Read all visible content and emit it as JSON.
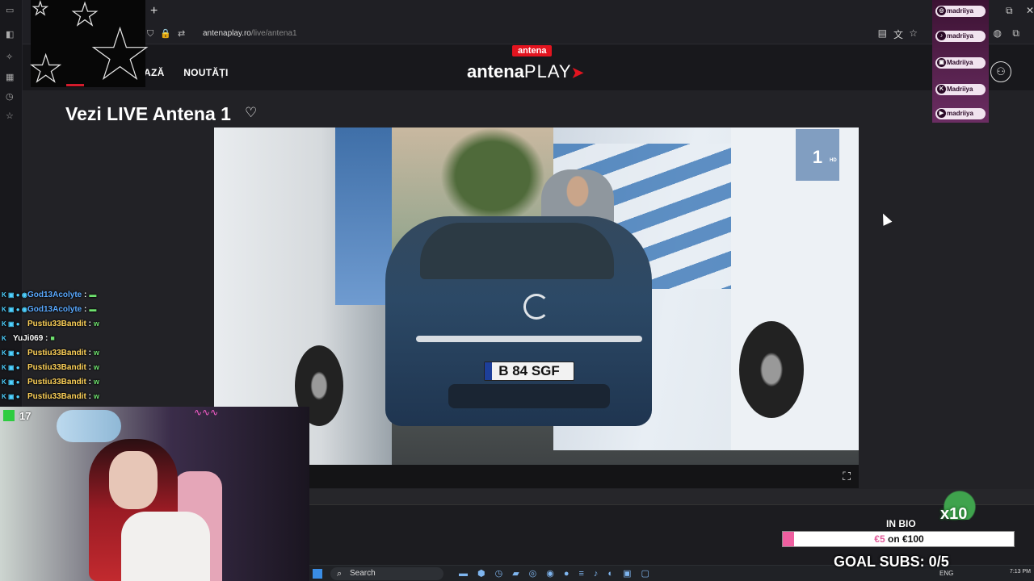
{
  "browser": {
    "new_tab_glyph": "+",
    "url_host": "antenaplay.ro",
    "url_path": "/live/antena1",
    "window_buttons": [
      "⧉",
      "✕"
    ]
  },
  "site": {
    "nav_left": [
      "AZĂ",
      "NOUTĂȚI"
    ],
    "brand_pill": "antena",
    "brand_word": "antena",
    "brand_play": "PLAY",
    "page_title": "Vezi LIVE Antena 1",
    "heart_icon": "♡",
    "user_icon": "⚇"
  },
  "video": {
    "channel_logo": "1",
    "channel_logo_hd": "HD",
    "plate": "B 84 SGF",
    "fullscreen_icon": "⛶"
  },
  "socials": [
    {
      "icon": "◎",
      "handle": "madriiya"
    },
    {
      "icon": "♪",
      "handle": "madriiya"
    },
    {
      "icon": "▣",
      "handle": "Madriiya"
    },
    {
      "icon": "K",
      "handle": "Madriiya"
    },
    {
      "icon": "▶",
      "handle": "madriiya"
    }
  ],
  "chat": [
    {
      "user": "God13Acolyte",
      "color": "blue",
      "emote": "▬"
    },
    {
      "user": "God13Acolyte",
      "color": "blue",
      "emote": "▬"
    },
    {
      "user": "Pustiu33Bandit",
      "color": "yellow",
      "emote": "w"
    },
    {
      "user": "YuJi069",
      "color": "white",
      "emote": "■"
    },
    {
      "user": "Pustiu33Bandit",
      "color": "yellow",
      "emote": "w"
    },
    {
      "user": "Pustiu33Bandit",
      "color": "yellow",
      "emote": "w"
    },
    {
      "user": "Pustiu33Bandit",
      "color": "yellow",
      "emote": "w"
    },
    {
      "user": "Pustiu33Bandit",
      "color": "yellow",
      "emote": "w"
    }
  ],
  "viewer_count": "17",
  "goal": {
    "x10": "x10",
    "in_bio": "IN BIO",
    "bar_amount": "€5",
    "bar_target": " on €100",
    "progress": 0.05,
    "subs_label": "GOAL SUBS: 0/5"
  },
  "taskbar": {
    "search_label": "Search",
    "tray_lang": "ENG",
    "clock": "7:13 PM"
  },
  "colors": {
    "brand_red": "#e3141f",
    "goal_pink": "#ef5fa0",
    "chat_blue": "#5aa9ff",
    "chat_yellow": "#ffd35a"
  }
}
